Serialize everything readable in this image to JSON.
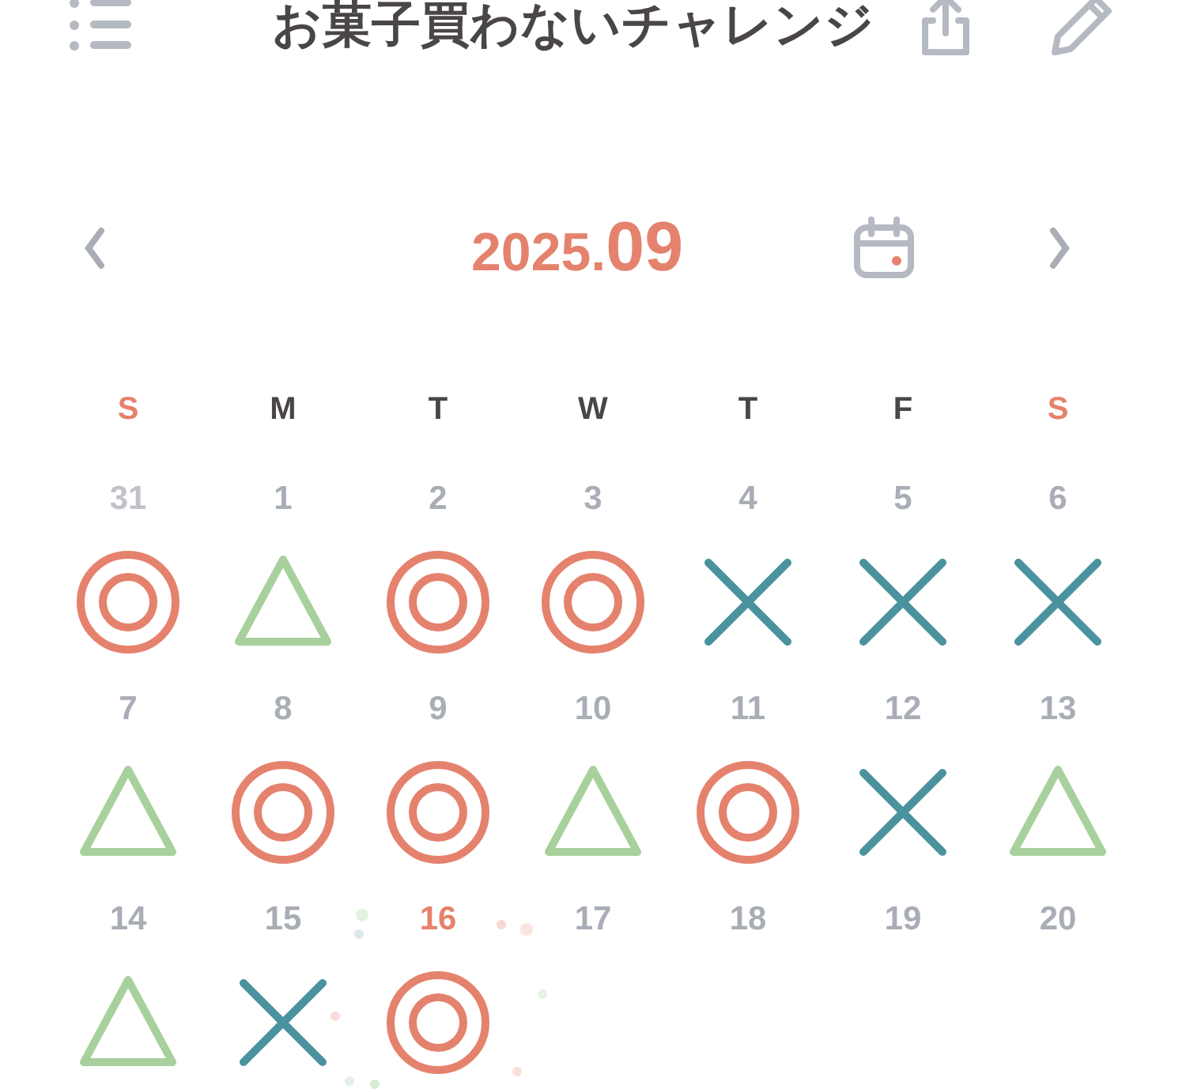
{
  "header": {
    "title": "お菓子買わないチャレンジ"
  },
  "month_nav": {
    "year": "2025.",
    "month": "09"
  },
  "weekdays": [
    {
      "label": "S",
      "weekend": true
    },
    {
      "label": "M",
      "weekend": false
    },
    {
      "label": "T",
      "weekend": false
    },
    {
      "label": "W",
      "weekend": false
    },
    {
      "label": "T",
      "weekend": false
    },
    {
      "label": "F",
      "weekend": false
    },
    {
      "label": "S",
      "weekend": true
    }
  ],
  "weeks": [
    [
      {
        "day": "31",
        "other_month": true,
        "today": false,
        "kind": "double-circle"
      },
      {
        "day": "1",
        "other_month": false,
        "today": false,
        "kind": "triangle"
      },
      {
        "day": "2",
        "other_month": false,
        "today": false,
        "kind": "double-circle"
      },
      {
        "day": "3",
        "other_month": false,
        "today": false,
        "kind": "double-circle"
      },
      {
        "day": "4",
        "other_month": false,
        "today": false,
        "kind": "cross"
      },
      {
        "day": "5",
        "other_month": false,
        "today": false,
        "kind": "cross"
      },
      {
        "day": "6",
        "other_month": false,
        "today": false,
        "kind": "cross"
      }
    ],
    [
      {
        "day": "7",
        "other_month": false,
        "today": false,
        "kind": "triangle"
      },
      {
        "day": "8",
        "other_month": false,
        "today": false,
        "kind": "double-circle"
      },
      {
        "day": "9",
        "other_month": false,
        "today": false,
        "kind": "double-circle"
      },
      {
        "day": "10",
        "other_month": false,
        "today": false,
        "kind": "triangle"
      },
      {
        "day": "11",
        "other_month": false,
        "today": false,
        "kind": "double-circle"
      },
      {
        "day": "12",
        "other_month": false,
        "today": false,
        "kind": "cross"
      },
      {
        "day": "13",
        "other_month": false,
        "today": false,
        "kind": "triangle"
      }
    ],
    [
      {
        "day": "14",
        "other_month": false,
        "today": false,
        "kind": "triangle"
      },
      {
        "day": "15",
        "other_month": false,
        "today": false,
        "kind": "cross"
      },
      {
        "day": "16",
        "other_month": false,
        "today": true,
        "kind": "double-circle"
      },
      {
        "day": "17",
        "other_month": false,
        "today": false,
        "kind": "none"
      },
      {
        "day": "18",
        "other_month": false,
        "today": false,
        "kind": "none"
      },
      {
        "day": "19",
        "other_month": false,
        "today": false,
        "kind": "none"
      },
      {
        "day": "20",
        "other_month": false,
        "today": false,
        "kind": "none"
      }
    ]
  ]
}
